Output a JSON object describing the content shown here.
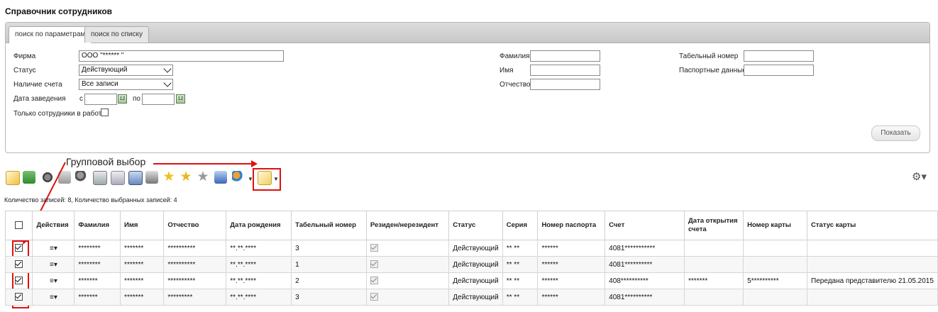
{
  "page_title": "Справочник сотрудников",
  "tabs": [
    {
      "label": "поиск по параметрам",
      "active": true
    },
    {
      "label": "поиск по списку",
      "active": false
    }
  ],
  "filters": {
    "firm_label": "Фирма",
    "firm_value": "ООО \"****** \"",
    "status_label": "Статус",
    "status_value": "Действующий",
    "account_label": "Наличие счета",
    "account_value": "Все записи",
    "date_label": "Дата заведения",
    "date_from_label": "с",
    "date_to_label": "по",
    "date_from_value": "",
    "date_to_value": "",
    "only_working_label": "Только сотрудники в работе",
    "surname_label": "Фамилия",
    "name_label": "Имя",
    "patronymic_label": "Отчество",
    "tab_number_label": "Табельный номер",
    "passport_label": "Паспортные данные",
    "show_button": "Показать"
  },
  "annotation": {
    "text": "Групповой выбор",
    "color": "#e01010"
  },
  "toolbar": {
    "icons": [
      "new-document-icon",
      "download-icon",
      "award-icon",
      "print-icon",
      "user-award-icon",
      "card-icon",
      "card-copy-icon",
      "card-delete-icon",
      "card-stack-icon",
      "star-icon",
      "star-add-icon",
      "star-grey-icon",
      "report-icon",
      "users-icon",
      "group-select-icon"
    ],
    "settings_icon": "gear-icon"
  },
  "count_text": "Количество записей: 8, Количество выбранных записей: 4",
  "table": {
    "headers": [
      "",
      "Действия",
      "Фамилия",
      "Имя",
      "Отчество",
      "Дата рождения",
      "Табельный номер",
      "Резиден/нерезидент",
      "Статус",
      "Серия",
      "Номер паспорта",
      "Счет",
      "Дата открытия счета",
      "Номер карты",
      "Статус карты"
    ],
    "rows": [
      {
        "checked": true,
        "surname": "********",
        "name": "*******",
        "patronymic": "**********",
        "birth": "**.**.****",
        "tab": "3",
        "resident": true,
        "status": "Действующий",
        "series": "** **",
        "passport": "******",
        "account": "4081***********",
        "open_date": "",
        "card": "",
        "card_status": ""
      },
      {
        "checked": true,
        "surname": "********",
        "name": "*******",
        "patronymic": "**********",
        "birth": "**.**.****",
        "tab": "1",
        "resident": true,
        "status": "Действующий",
        "series": "** **",
        "passport": "******",
        "account": "4081**********",
        "open_date": "",
        "card": "",
        "card_status": ""
      },
      {
        "checked": true,
        "surname": "*******",
        "name": "*******",
        "patronymic": "**********",
        "birth": "**.**.****",
        "tab": "2",
        "resident": true,
        "status": "Действующий",
        "series": "** **",
        "passport": "******",
        "account": "408**********",
        "open_date": "*******",
        "card": "5**********",
        "card_status": "Передана представителю 21.05.2015"
      },
      {
        "checked": true,
        "surname": "*******",
        "name": "*******",
        "patronymic": "*********",
        "birth": "**.**.****",
        "tab": "3",
        "resident": true,
        "status": "Действующий",
        "series": "** **",
        "passport": "******",
        "account": "4081**********",
        "open_date": "",
        "card": "",
        "card_status": ""
      }
    ]
  }
}
